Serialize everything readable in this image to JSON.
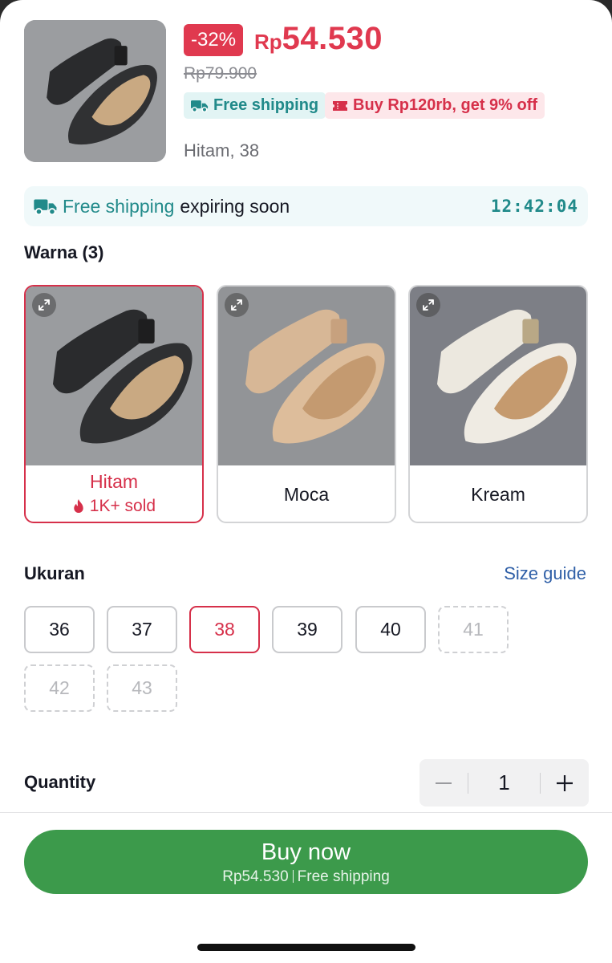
{
  "product": {
    "discount": "-32%",
    "currency": "Rp",
    "price": "54.530",
    "original_price": "Rp79.900",
    "badge_shipping": "Free shipping",
    "badge_offer": "Buy Rp120rb, get 9% off",
    "selected_variant": "Hitam, 38",
    "thumb_icon": "shoe-photo"
  },
  "promo": {
    "label_highlight": "Free shipping",
    "label_rest": "expiring soon",
    "countdown": "12:42:04"
  },
  "colors": {
    "title": "Warna (3)",
    "items": [
      {
        "label": "Hitam",
        "sold": "1K+ sold",
        "selected": true
      },
      {
        "label": "Moca",
        "sold": "",
        "selected": false
      },
      {
        "label": "Kream",
        "sold": "",
        "selected": false
      }
    ]
  },
  "sizes": {
    "title": "Ukuran",
    "guide_label": "Size guide",
    "items": [
      {
        "label": "36",
        "state": "available"
      },
      {
        "label": "37",
        "state": "available"
      },
      {
        "label": "38",
        "state": "selected"
      },
      {
        "label": "39",
        "state": "available"
      },
      {
        "label": "40",
        "state": "available"
      },
      {
        "label": "41",
        "state": "disabled"
      },
      {
        "label": "42",
        "state": "disabled"
      },
      {
        "label": "43",
        "state": "disabled"
      }
    ]
  },
  "quantity": {
    "title": "Quantity",
    "value": "1"
  },
  "buy": {
    "label": "Buy now",
    "sub_price": "Rp54.530",
    "sub_shipping": "Free shipping"
  },
  "colors_theme": {
    "accent": "#e0394f",
    "shipping": "#218a8a",
    "buy_button": "#3c9a4b",
    "link": "#2f5fa7"
  }
}
